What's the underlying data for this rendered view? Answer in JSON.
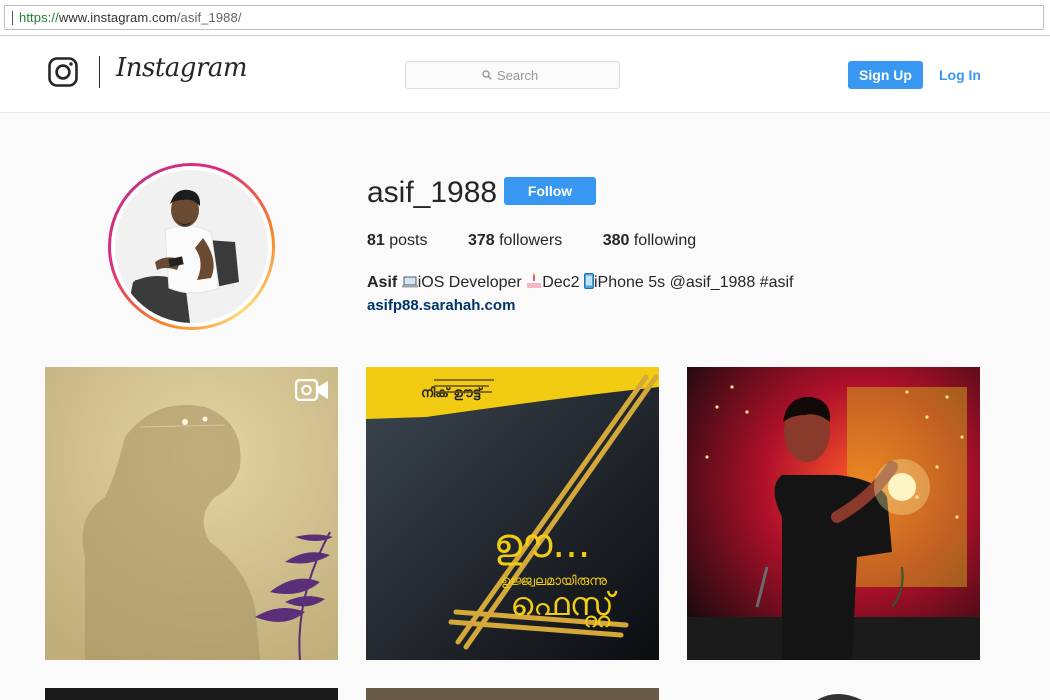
{
  "browser": {
    "url_scheme": "https://",
    "url_host": "www.instagram.com",
    "url_path": "/asif_1988/"
  },
  "header": {
    "brand": "Instagram",
    "search_placeholder": "Search",
    "signup_label": "Sign Up",
    "login_label": "Log In"
  },
  "profile": {
    "username": "asif_1988",
    "follow_label": "Follow",
    "posts_count": "81",
    "posts_label": "posts",
    "followers_count": "378",
    "followers_label": "followers",
    "following_count": "380",
    "following_label": "following",
    "bio_name": "Asif",
    "bio_part1": "iOS Developer ",
    "bio_part2": "Dec2 ",
    "bio_part3": "iPhone 5s @asif_1988 #asif",
    "website": "asifp88.sarahah.com"
  },
  "posts": [
    {
      "type": "video",
      "icon": "video-camera-icon"
    },
    {
      "type": "image",
      "text_line1": "ഊ...",
      "text_line2": "ഉജ്ജ്വലമായിരുന്നു",
      "text_line3": "ഫെസ്റ്റ്",
      "banner_title": "നിക് ഊട്ട്"
    },
    {
      "type": "image"
    },
    {
      "type": "image"
    },
    {
      "type": "image"
    },
    {
      "type": "image"
    }
  ],
  "colors": {
    "accent": "#3897f0",
    "link": "#003569",
    "background": "#fafafa"
  }
}
